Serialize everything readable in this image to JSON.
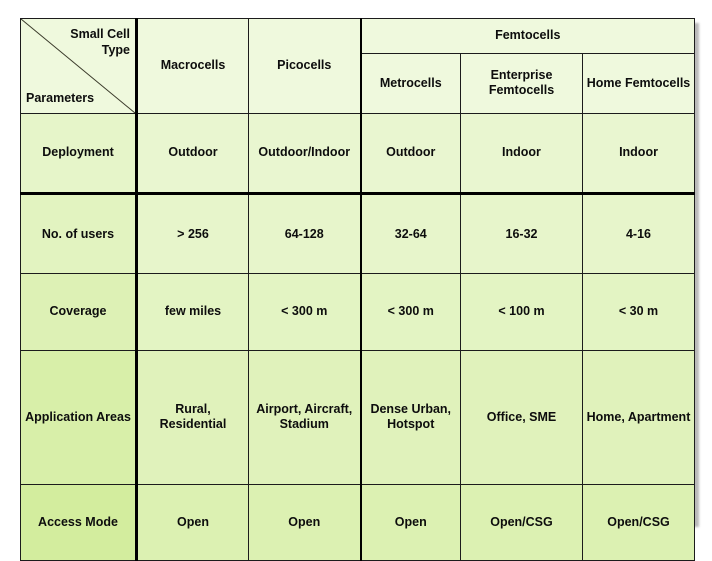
{
  "table": {
    "corner": {
      "top_right_label": "Small Cell Type",
      "bottom_left_label": "Parameters"
    },
    "columns": {
      "macrocells": "Macrocells",
      "picocells": "Picocells",
      "femtocells_group": "Femtocells",
      "metrocells": "Metrocells",
      "enterprise_femtocells": "Enterprise Femtocells",
      "home_femtocells": "Home Femtocells"
    },
    "rows": [
      {
        "parameter": "Deployment",
        "macrocells": "Outdoor",
        "picocells": "Outdoor/Indoor",
        "metrocells": "Outdoor",
        "enterprise_femtocells": "Indoor",
        "home_femtocells": "Indoor"
      },
      {
        "parameter": "No. of users",
        "macrocells": "> 256",
        "picocells": "64-128",
        "metrocells": "32-64",
        "enterprise_femtocells": "16-32",
        "home_femtocells": "4-16"
      },
      {
        "parameter": "Coverage",
        "macrocells": "few miles",
        "picocells": "< 300 m",
        "metrocells": "< 300 m",
        "enterprise_femtocells": "< 100 m",
        "home_femtocells": "< 30 m"
      },
      {
        "parameter": "Application Areas",
        "macrocells": "Rural, Residential",
        "picocells": "Airport, Aircraft, Stadium",
        "metrocells": "Dense Urban, Hotspot",
        "enterprise_femtocells": "Office, SME",
        "home_femtocells": "Home, Apartment"
      },
      {
        "parameter": "Access Mode",
        "macrocells": "Open",
        "picocells": "Open",
        "metrocells": "Open",
        "enterprise_femtocells": "Open/CSG",
        "home_femtocells": "Open/CSG"
      }
    ]
  },
  "colors": {
    "cell_fill": "#e9f6d0",
    "header_fill": "#eff9dd",
    "border": "#1c1c1c",
    "text": "#0d0d0d",
    "page_background": "#ffffff"
  }
}
